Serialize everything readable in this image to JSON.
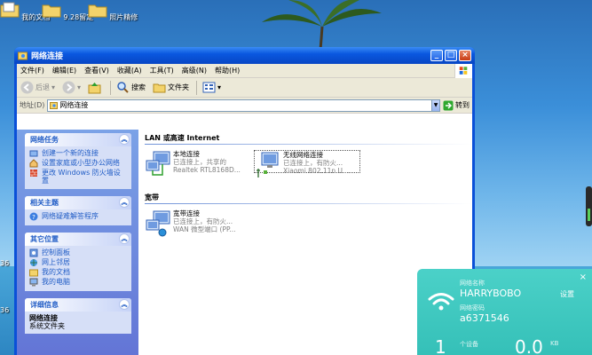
{
  "desktop": {
    "icons": [
      {
        "label": "我的文档"
      },
      {
        "label": "9.28留定"
      },
      {
        "label": "照片精修"
      }
    ],
    "side_labels": [
      "36",
      "36"
    ]
  },
  "window": {
    "title": "网络连接",
    "buttons": {
      "minimize": "_",
      "maximize": "□",
      "close": "×"
    }
  },
  "menu": [
    "文件(F)",
    "编辑(E)",
    "查看(V)",
    "收藏(A)",
    "工具(T)",
    "高级(N)",
    "帮助(H)"
  ],
  "toolbar": {
    "back": "后退",
    "search": "搜索",
    "folders": "文件夹"
  },
  "address": {
    "label": "地址(D)",
    "value": "网络连接",
    "go": "转到"
  },
  "taskpane": {
    "network_tasks": {
      "title": "网络任务",
      "links": [
        "创建一个新的连接",
        "设置家庭或小型办公网络",
        "更改 Windows 防火墙设置"
      ]
    },
    "see_also": {
      "title": "相关主题",
      "links": [
        "网络疑难解答程序"
      ]
    },
    "other_places": {
      "title": "其它位置",
      "links": [
        "控制面板",
        "网上邻居",
        "我的文档",
        "我的电脑"
      ]
    },
    "details": {
      "title": "详细信息",
      "lines": [
        "网络连接",
        "系统文件夹"
      ]
    }
  },
  "groups": [
    {
      "title": "LAN 或高速 Internet",
      "items": [
        {
          "name": "本地连接",
          "status": "已连接上，共享的",
          "device": "Realtek RTL8168D..."
        },
        {
          "name": "无线网络连接",
          "status": "已连接上，有防火...",
          "device": "Xiaomi 802.11n U..."
        }
      ]
    },
    {
      "title": "宽带",
      "items": [
        {
          "name": "宽带连接",
          "status": "已连接上，有防火...",
          "device": "WAN 微型端口 (PP..."
        }
      ]
    }
  ],
  "wifi_widget": {
    "close": "×",
    "name_label": "网络名称",
    "name": "HARRYBOBO",
    "pwd_label": "网络密码",
    "password": "a6371546",
    "settings": "设置",
    "count": "1",
    "count_label": "个设备",
    "speed": "0.0",
    "speed_unit": "KB"
  },
  "colors": {
    "title_blue": "#0a58e0",
    "taskpane_link": "#215dc6",
    "wifi_teal": "#35c0b8"
  }
}
